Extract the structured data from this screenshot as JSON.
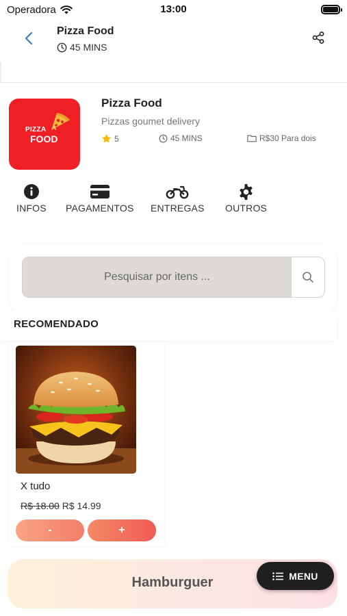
{
  "status_bar": {
    "carrier": "Operadora",
    "time": "13:00"
  },
  "header": {
    "title": "Pizza Food",
    "delivery_time": "45 MINS"
  },
  "store": {
    "logo_line1": "PIZZA",
    "logo_line2": "FOOD",
    "name": "Pizza Food",
    "description": "Pizzas goumet delivery",
    "rating": "5",
    "delivery_time": "45 MINS",
    "price_for_two": "R$30 Para dois"
  },
  "info_tabs": [
    {
      "label": "INFOS",
      "icon": "info-icon"
    },
    {
      "label": "PAGAMENTOS",
      "icon": "credit-card-icon"
    },
    {
      "label": "ENTREGAS",
      "icon": "motorcycle-icon"
    },
    {
      "label": "OUTROS",
      "icon": "gear-icon"
    }
  ],
  "search": {
    "placeholder": "Pesquisar por itens ..."
  },
  "section": {
    "title": "RECOMENDADO"
  },
  "products": [
    {
      "name": "X tudo",
      "old_price": "R$ 18.00",
      "price": "R$ 14.99",
      "minus_label": "-",
      "plus_label": "+"
    }
  ],
  "category_bar": {
    "label": "Hamburguer"
  },
  "menu_button": {
    "label": "MENU"
  },
  "colors": {
    "brand_red": "#ee1f25",
    "accent_orange": "#f15a55",
    "back_arrow": "#3a7bd5",
    "star": "#f5b800"
  }
}
